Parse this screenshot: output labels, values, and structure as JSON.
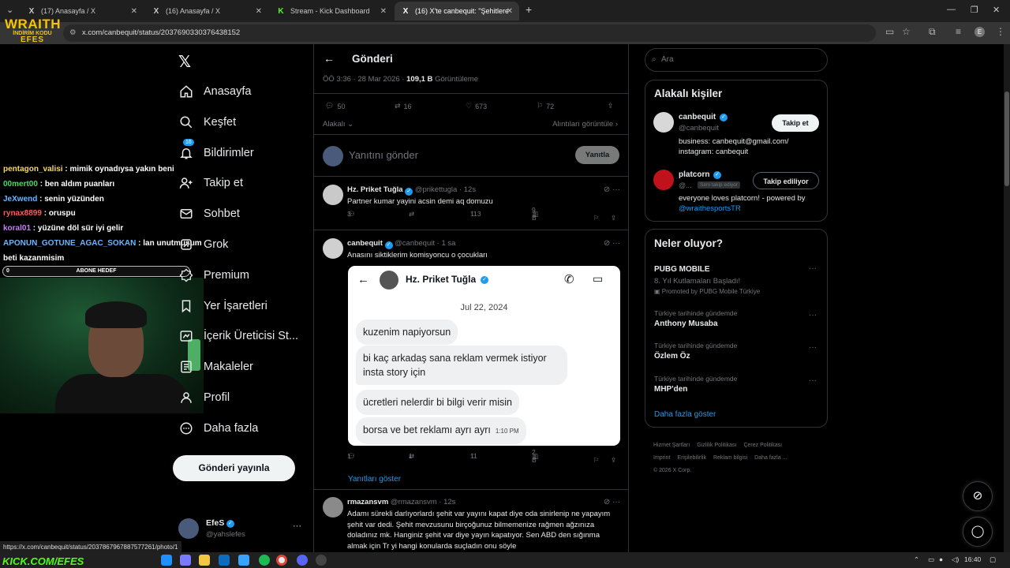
{
  "browser": {
    "tabs": [
      {
        "icon": "X",
        "title": "(17) Anasayfa / X"
      },
      {
        "icon": "X",
        "title": "(16) Anasayfa / X"
      },
      {
        "icon": "K",
        "title": "Stream - Kick Dashboard"
      },
      {
        "icon": "X",
        "title": "(16) X'te canbequit: \"Şehitlere i..."
      }
    ],
    "url": "x.com/canbequit/status/2037690330376438152",
    "status_url": "https://x.com/canbequit/status/2037867967887577261/photo/1"
  },
  "overlay": {
    "logo_line1": "WRAITH",
    "logo_line2": "İNDİRİM KODU",
    "logo_line3": "EFES",
    "goal_count": "0",
    "goal_label": "ABONE HEDEF",
    "kick_url": "KICK.COM/EFES",
    "chat": [
      {
        "user": "pentagon_valisi",
        "color": "#f5d76e",
        "text": "mimik oynadıysa yakın beni"
      },
      {
        "user": "00mert00",
        "color": "#4cd964",
        "text": "ben aldım puanları"
      },
      {
        "user": "JeXwend",
        "color": "#6cb4ff",
        "text": "senin yüzünden"
      },
      {
        "user": "rynax8899",
        "color": "#ff5a5a",
        "text": "oruspu"
      },
      {
        "user": "koral01",
        "color": "#c77dff",
        "text": "yüzüne döl sür iyi gelir"
      },
      {
        "user": "APONUN_GOTUNE_AGAC_SOKAN",
        "color": "#6cb4ff",
        "text": "lan unutmuşum"
      },
      {
        "user": "",
        "color": "#ffffff",
        "text": "beti kazanmisim"
      }
    ]
  },
  "nav": {
    "items": [
      {
        "icon": "home-icon",
        "label": "Anasayfa"
      },
      {
        "icon": "search-icon",
        "label": "Keşfet"
      },
      {
        "icon": "bell-icon",
        "label": "Bildirimler",
        "badge": "16"
      },
      {
        "icon": "follow-icon",
        "label": "Takip et"
      },
      {
        "icon": "mail-icon",
        "label": "Sohbet"
      },
      {
        "icon": "grok-icon",
        "label": "Grok"
      },
      {
        "icon": "premium-icon",
        "label": "Premium"
      },
      {
        "icon": "bookmark-icon",
        "label": "Yer İşaretleri"
      },
      {
        "icon": "creator-icon",
        "label": "İçerik Üreticisi St..."
      },
      {
        "icon": "article-icon",
        "label": "Makaleler"
      },
      {
        "icon": "profile-icon",
        "label": "Profil"
      },
      {
        "icon": "more-icon",
        "label": "Daha fazla"
      }
    ],
    "post_button": "Gönderi yayınla",
    "account_name": "EfeS",
    "account_handle": "@yahslefes"
  },
  "post": {
    "header_title": "Gönderi",
    "time": "ÖÖ 3:36 · 28 Mar 2026 · ",
    "views": "109,1 B",
    "views_label": "Görüntüleme",
    "replies": "50",
    "reposts": "16",
    "likes": "673",
    "bookmarks": "72",
    "sort_label": "Alakalı",
    "quotes_label": "Alıntıları görüntüle",
    "reply_placeholder": "Yanıtını gönder",
    "reply_button": "Yanıtla"
  },
  "replies": [
    {
      "name": "Hz. Priket Tuğla",
      "handle": "@prikettugla · 12s",
      "text": "Partner kumar yayini acsin demi aq domuzu",
      "replies": "3",
      "reposts": "",
      "likes": "113",
      "views": "9 B"
    },
    {
      "name": "canbequit",
      "handle": "@canbequit · 1 sa",
      "text": "Anasını siktiklerim komisyoncu o çocukları",
      "replies": "1",
      "reposts": "1",
      "likes": "11",
      "views": "2 B"
    },
    {
      "name": "rmazansvm",
      "handle": "@rmazansvm · 12s",
      "text": "Adamı sürekli darlıyorlardı şehit var yayını kapat diye oda sinirlenip ne yapayım şehit var dedi. Şehit mevzusunu birçoğunuz bilmemenize rağmen ağzınıza doladınız mk. Hanginiz şehit var diye yayın kapatıyor.  Sen ABD den sığınma almak için Tr yi hangi konularda suçladın onu söyle"
    }
  ],
  "dm_screenshot": {
    "name": "Hz. Priket Tuğla",
    "date": "Jul 22, 2024",
    "messages": [
      "kuzenim napiyorsun",
      "bi kaç arkadaş sana reklam vermek istiyor",
      "insta story için",
      "ücretleri nelerdir bi bilgi verir misin",
      "borsa ve bet reklamı ayrı ayrı"
    ],
    "time": "1:10 PM"
  },
  "show_replies": "Yanıtları göster",
  "right": {
    "search_placeholder": "Ara",
    "people_title": "Alakalı kişiler",
    "people": [
      {
        "name": "canbequit",
        "handle": "@canbequit",
        "button": "Takip et",
        "bio": "business: canbequit@gmail.com/ instagram: canbequit"
      },
      {
        "name": "platcorn",
        "handle": "@...",
        "follows_you": "Seni takip ediyor",
        "button": "Takip ediliyor",
        "bio": "everyone loves platcorn! - powered by ",
        "bio_link": "@wraithesportsTR"
      }
    ],
    "trends_title": "Neler oluyor?",
    "promoted": {
      "title": "PUBG MOBILE",
      "sub": "8. Yıl Kutlamaları Başladı!",
      "promo": "Promoted by PUBG Mobile Türkiye"
    },
    "trends": [
      {
        "cat": "Türkiye tarihinde gündemde",
        "title": "Anthony Musaba"
      },
      {
        "cat": "Türkiye tarihinde gündemde",
        "title": "Özlem Öz"
      },
      {
        "cat": "Türkiye tarihinde gündemde",
        "title": "MHP'den"
      }
    ],
    "show_more": "Daha fazla göster",
    "footer": [
      "Hizmet Şartları",
      "Gizlilik Politikası",
      "Çerez Politikası",
      "Imprint",
      "Erişilebilirlik",
      "Reklam bilgisi",
      "Daha fazla ...",
      "© 2026 X Corp."
    ]
  },
  "taskbar": {
    "time": "16:40"
  }
}
